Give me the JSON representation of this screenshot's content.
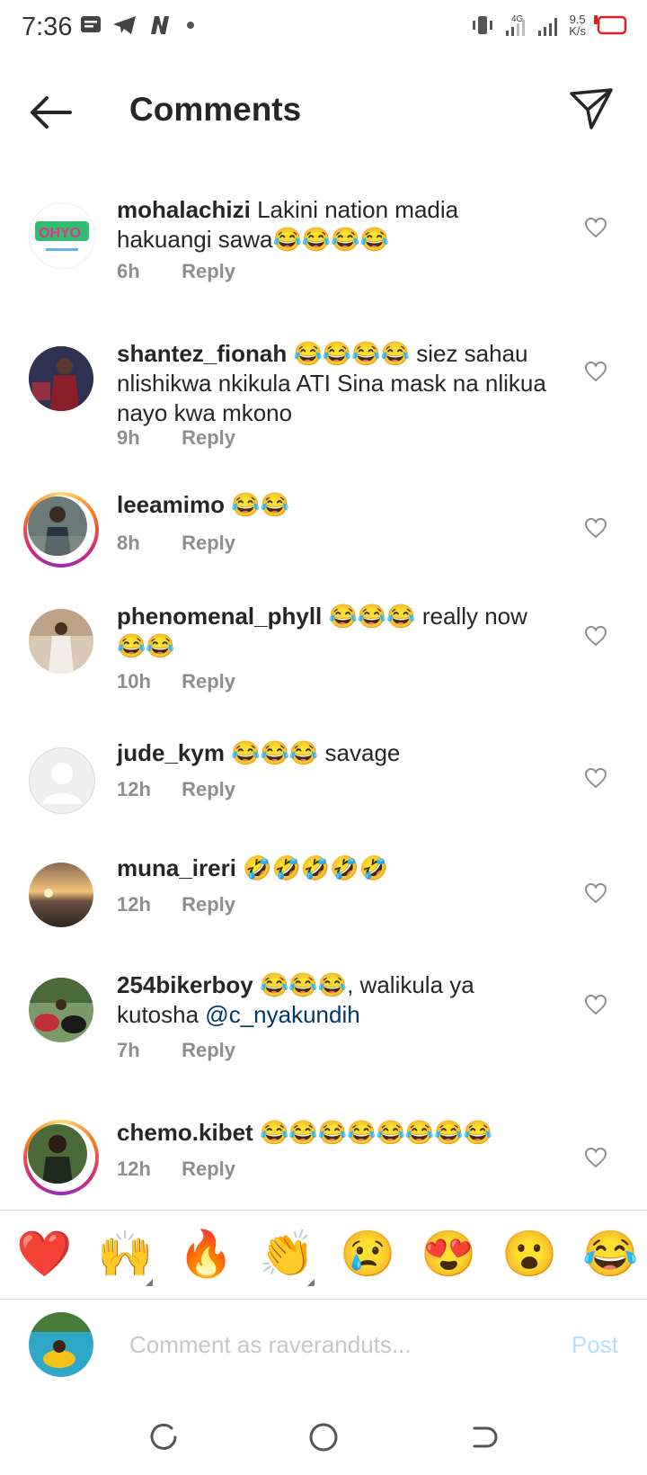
{
  "status_bar": {
    "time": "7:36",
    "net_speed_value": "9.5",
    "net_speed_unit": "K/s",
    "network_type": "4G",
    "battery_color": "#e02020"
  },
  "header": {
    "title": "Comments"
  },
  "comments": [
    {
      "username": "mohalachizi",
      "text": "Lakini nation madia hakuangi sawa😂😂😂😂",
      "time": "6h",
      "reply": "Reply",
      "story_ring": false
    },
    {
      "username": "shantez_fionah",
      "text": "😂😂😂😂 siez sahau nlishikwa nkikula ATI Sina mask na nlikua nayo kwa mkono",
      "time": "9h",
      "reply": "Reply",
      "story_ring": false
    },
    {
      "username": "leeamimo",
      "text": "😂😂",
      "time": "8h",
      "reply": "Reply",
      "story_ring": true
    },
    {
      "username": "phenomenal_phyll",
      "text": "😂😂😂 really now 😂😂",
      "time": "10h",
      "reply": "Reply",
      "story_ring": false
    },
    {
      "username": "jude_kym",
      "text": "😂😂😂 savage",
      "time": "12h",
      "reply": "Reply",
      "story_ring": false
    },
    {
      "username": "muna_ireri",
      "text": "🤣🤣🤣🤣🤣",
      "time": "12h",
      "reply": "Reply",
      "story_ring": false
    },
    {
      "username": "254bikerboy",
      "text": "😂😂😂, walikula ya kutosha ",
      "mention": "@c_nyakundih",
      "time": "7h",
      "reply": "Reply",
      "story_ring": false
    },
    {
      "username": "chemo.kibet",
      "text": "😂😂😂😂😂😂😂😂",
      "time": "12h",
      "reply": "Reply",
      "story_ring": true
    }
  ],
  "emoji_bar": [
    "❤️",
    "🙌",
    "🔥",
    "👏",
    "😢",
    "😍",
    "😮",
    "😂"
  ],
  "composer": {
    "placeholder": "Comment as raveranduts...",
    "post_label": "Post"
  },
  "colors": {
    "mention": "#00376b",
    "post_disabled": "#b2dffc",
    "meta_gray": "#8e8e8e"
  }
}
